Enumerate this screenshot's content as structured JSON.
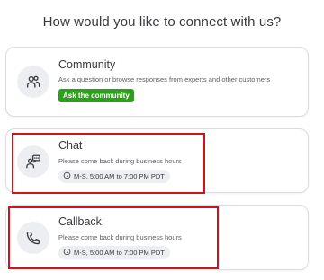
{
  "heading": "How would you like to connect with us?",
  "options": {
    "community": {
      "title": "Community",
      "description": "Ask a question or browse responses from experts and other customers",
      "button": "Ask the community",
      "icon": "community-people-icon"
    },
    "chat": {
      "title": "Chat",
      "description": "Please come back during business hours",
      "hours": "M-S, 5:00 AM to 7:00 PM PDT",
      "icon": "chat-agent-icon"
    },
    "callback": {
      "title": "Callback",
      "description": "Please come back during business hours",
      "hours": "M-S, 5:00 AM to 7:00 PM PDT",
      "icon": "phone-icon"
    }
  },
  "colors": {
    "accent_green": "#2ca01c",
    "highlight_red": "#d0121b",
    "text": "#393a3d"
  }
}
